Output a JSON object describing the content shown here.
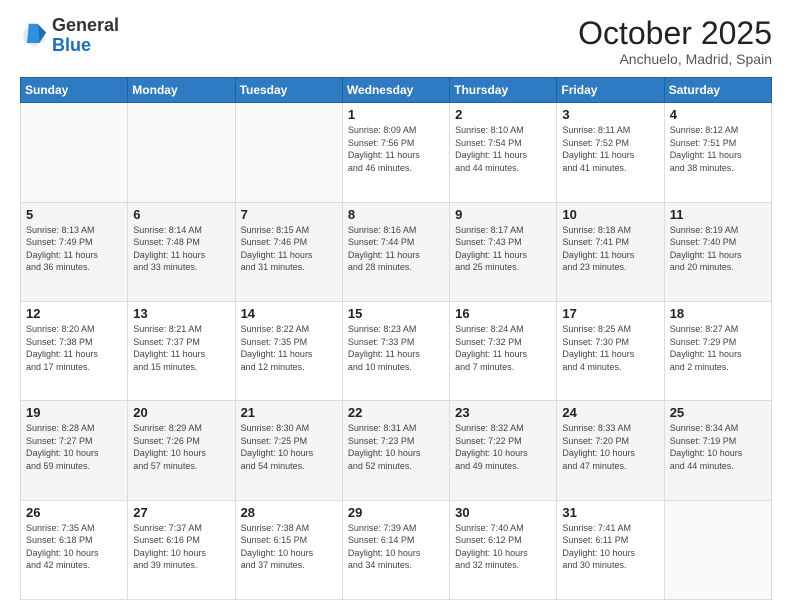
{
  "header": {
    "logo_general": "General",
    "logo_blue": "Blue",
    "month": "October 2025",
    "location": "Anchuelo, Madrid, Spain"
  },
  "weekdays": [
    "Sunday",
    "Monday",
    "Tuesday",
    "Wednesday",
    "Thursday",
    "Friday",
    "Saturday"
  ],
  "weeks": [
    [
      {
        "day": "",
        "info": ""
      },
      {
        "day": "",
        "info": ""
      },
      {
        "day": "",
        "info": ""
      },
      {
        "day": "1",
        "info": "Sunrise: 8:09 AM\nSunset: 7:56 PM\nDaylight: 11 hours\nand 46 minutes."
      },
      {
        "day": "2",
        "info": "Sunrise: 8:10 AM\nSunset: 7:54 PM\nDaylight: 11 hours\nand 44 minutes."
      },
      {
        "day": "3",
        "info": "Sunrise: 8:11 AM\nSunset: 7:52 PM\nDaylight: 11 hours\nand 41 minutes."
      },
      {
        "day": "4",
        "info": "Sunrise: 8:12 AM\nSunset: 7:51 PM\nDaylight: 11 hours\nand 38 minutes."
      }
    ],
    [
      {
        "day": "5",
        "info": "Sunrise: 8:13 AM\nSunset: 7:49 PM\nDaylight: 11 hours\nand 36 minutes."
      },
      {
        "day": "6",
        "info": "Sunrise: 8:14 AM\nSunset: 7:48 PM\nDaylight: 11 hours\nand 33 minutes."
      },
      {
        "day": "7",
        "info": "Sunrise: 8:15 AM\nSunset: 7:46 PM\nDaylight: 11 hours\nand 31 minutes."
      },
      {
        "day": "8",
        "info": "Sunrise: 8:16 AM\nSunset: 7:44 PM\nDaylight: 11 hours\nand 28 minutes."
      },
      {
        "day": "9",
        "info": "Sunrise: 8:17 AM\nSunset: 7:43 PM\nDaylight: 11 hours\nand 25 minutes."
      },
      {
        "day": "10",
        "info": "Sunrise: 8:18 AM\nSunset: 7:41 PM\nDaylight: 11 hours\nand 23 minutes."
      },
      {
        "day": "11",
        "info": "Sunrise: 8:19 AM\nSunset: 7:40 PM\nDaylight: 11 hours\nand 20 minutes."
      }
    ],
    [
      {
        "day": "12",
        "info": "Sunrise: 8:20 AM\nSunset: 7:38 PM\nDaylight: 11 hours\nand 17 minutes."
      },
      {
        "day": "13",
        "info": "Sunrise: 8:21 AM\nSunset: 7:37 PM\nDaylight: 11 hours\nand 15 minutes."
      },
      {
        "day": "14",
        "info": "Sunrise: 8:22 AM\nSunset: 7:35 PM\nDaylight: 11 hours\nand 12 minutes."
      },
      {
        "day": "15",
        "info": "Sunrise: 8:23 AM\nSunset: 7:33 PM\nDaylight: 11 hours\nand 10 minutes."
      },
      {
        "day": "16",
        "info": "Sunrise: 8:24 AM\nSunset: 7:32 PM\nDaylight: 11 hours\nand 7 minutes."
      },
      {
        "day": "17",
        "info": "Sunrise: 8:25 AM\nSunset: 7:30 PM\nDaylight: 11 hours\nand 4 minutes."
      },
      {
        "day": "18",
        "info": "Sunrise: 8:27 AM\nSunset: 7:29 PM\nDaylight: 11 hours\nand 2 minutes."
      }
    ],
    [
      {
        "day": "19",
        "info": "Sunrise: 8:28 AM\nSunset: 7:27 PM\nDaylight: 10 hours\nand 59 minutes."
      },
      {
        "day": "20",
        "info": "Sunrise: 8:29 AM\nSunset: 7:26 PM\nDaylight: 10 hours\nand 57 minutes."
      },
      {
        "day": "21",
        "info": "Sunrise: 8:30 AM\nSunset: 7:25 PM\nDaylight: 10 hours\nand 54 minutes."
      },
      {
        "day": "22",
        "info": "Sunrise: 8:31 AM\nSunset: 7:23 PM\nDaylight: 10 hours\nand 52 minutes."
      },
      {
        "day": "23",
        "info": "Sunrise: 8:32 AM\nSunset: 7:22 PM\nDaylight: 10 hours\nand 49 minutes."
      },
      {
        "day": "24",
        "info": "Sunrise: 8:33 AM\nSunset: 7:20 PM\nDaylight: 10 hours\nand 47 minutes."
      },
      {
        "day": "25",
        "info": "Sunrise: 8:34 AM\nSunset: 7:19 PM\nDaylight: 10 hours\nand 44 minutes."
      }
    ],
    [
      {
        "day": "26",
        "info": "Sunrise: 7:35 AM\nSunset: 6:18 PM\nDaylight: 10 hours\nand 42 minutes."
      },
      {
        "day": "27",
        "info": "Sunrise: 7:37 AM\nSunset: 6:16 PM\nDaylight: 10 hours\nand 39 minutes."
      },
      {
        "day": "28",
        "info": "Sunrise: 7:38 AM\nSunset: 6:15 PM\nDaylight: 10 hours\nand 37 minutes."
      },
      {
        "day": "29",
        "info": "Sunrise: 7:39 AM\nSunset: 6:14 PM\nDaylight: 10 hours\nand 34 minutes."
      },
      {
        "day": "30",
        "info": "Sunrise: 7:40 AM\nSunset: 6:12 PM\nDaylight: 10 hours\nand 32 minutes."
      },
      {
        "day": "31",
        "info": "Sunrise: 7:41 AM\nSunset: 6:11 PM\nDaylight: 10 hours\nand 30 minutes."
      },
      {
        "day": "",
        "info": ""
      }
    ]
  ]
}
